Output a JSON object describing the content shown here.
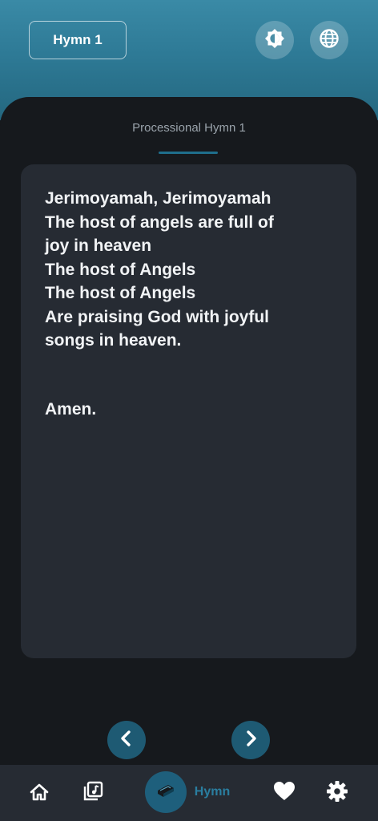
{
  "header": {
    "hymn_button_label": "Hymn 1",
    "theme_icon": "brightness-icon",
    "language_icon": "globe-icon"
  },
  "tab": {
    "title": "Processional Hymn 1"
  },
  "lyrics": {
    "lines": [
      "Jerimoyamah, Jerimoyamah",
      "The host of angels are full of",
      "joy in heaven",
      "The host of Angels",
      "The host of Angels",
      "Are praising God with joyful",
      "songs in heaven."
    ],
    "closing": "Amen."
  },
  "pager": {
    "prev_icon": "chevron-left-icon",
    "next_icon": "chevron-right-icon"
  },
  "bottom_nav": {
    "items": [
      {
        "icon": "home-icon"
      },
      {
        "icon": "music-library-icon"
      },
      {
        "icon": "book-icon",
        "label": "Hymn"
      },
      {
        "icon": "heart-icon"
      },
      {
        "icon": "gear-icon"
      }
    ]
  },
  "colors": {
    "header_top": "#3a8aa6",
    "header_bottom": "#24677f",
    "background": "#16191d",
    "card": "#262b33",
    "accent": "#1e5f7c",
    "accent_text": "#2a7ea0",
    "lyric_text": "#f1f3f5"
  }
}
